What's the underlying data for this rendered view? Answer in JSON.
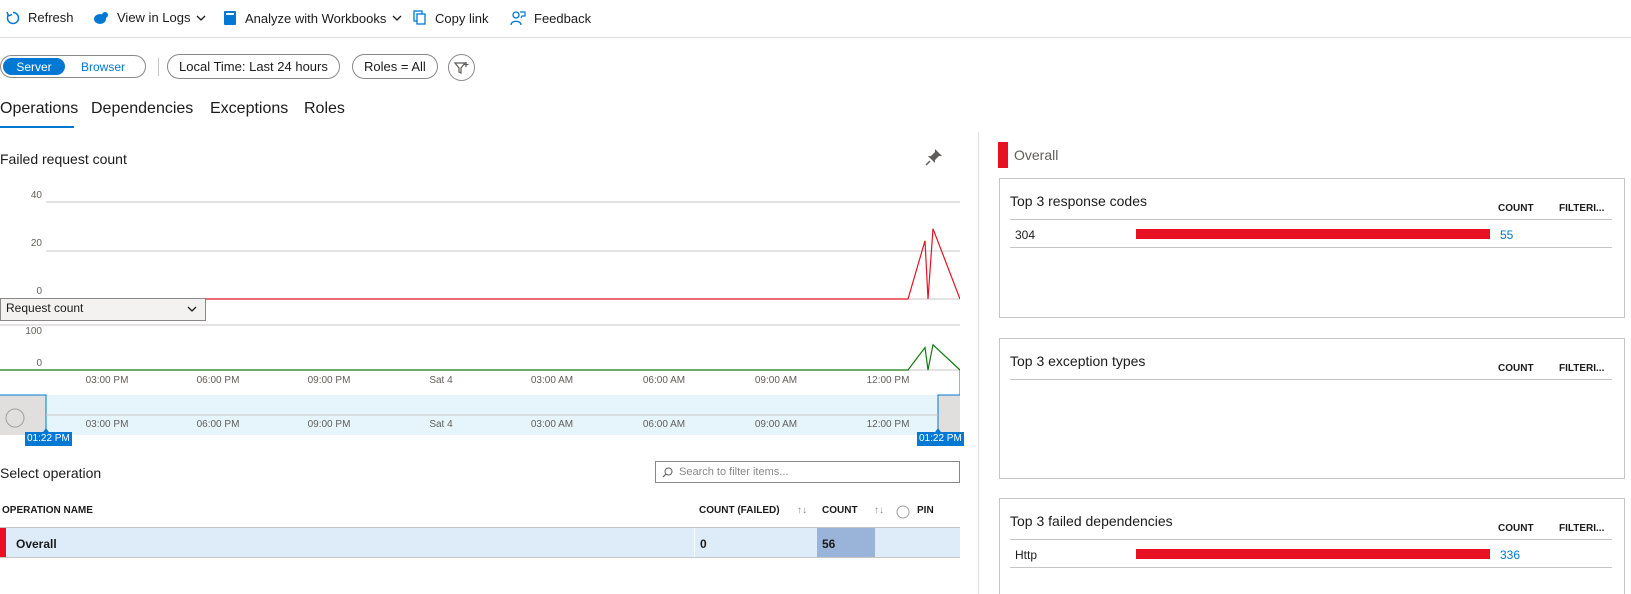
{
  "toolbar": {
    "refresh": "Refresh",
    "view_in_logs": "View in Logs",
    "analyze_workbooks": "Analyze with Workbooks",
    "copy_link": "Copy link",
    "feedback": "Feedback"
  },
  "filters": {
    "server": "Server",
    "browser": "Browser",
    "time_range": "Local Time: Last 24 hours",
    "roles": "Roles = All"
  },
  "tabs": [
    "Operations",
    "Dependencies",
    "Exceptions",
    "Roles"
  ],
  "main_chart": {
    "title": "Failed request count",
    "y_ticks": [
      "40",
      "20",
      "0"
    ]
  },
  "secondary_chart": {
    "metric_selected": "Request count",
    "y_ticks": [
      "100",
      "0"
    ]
  },
  "time_axis": [
    "03:00 PM",
    "06:00 PM",
    "09:00 PM",
    "Sat 4",
    "03:00 AM",
    "06:00 AM",
    "09:00 AM",
    "12:00 PM"
  ],
  "brush": {
    "start_label": "01:22 PM",
    "end_label": "01:22 PM"
  },
  "chart_data": [
    {
      "type": "line",
      "title": "Failed request count",
      "ylim": [
        0,
        40
      ],
      "grid": true,
      "series": [
        {
          "color": "#e81123",
          "x": [
            "01:22 PM",
            "12:00 PM",
            "12:30 PM",
            "12:45 PM",
            "01:00 PM",
            "01:10 PM",
            "01:22 PM"
          ],
          "values": [
            0,
            0,
            0,
            24,
            0,
            29,
            0
          ]
        }
      ]
    },
    {
      "type": "line",
      "ylim": [
        0,
        100
      ],
      "series": [
        {
          "color": "#107c10",
          "x": [
            "01:22 PM",
            "12:00 PM",
            "12:30 PM",
            "12:45 PM",
            "01:00 PM",
            "01:10 PM",
            "01:22 PM"
          ],
          "values": [
            0,
            0,
            0,
            50,
            0,
            56,
            0
          ]
        }
      ]
    }
  ],
  "operations": {
    "title": "Select operation",
    "search_placeholder": "Search to filter items...",
    "headers": {
      "name": "OPERATION NAME",
      "count_failed": "COUNT (FAILED)",
      "count": "COUNT",
      "pin": "PIN"
    },
    "rows": [
      {
        "name": "Overall",
        "count_failed": "0",
        "count": "56"
      }
    ]
  },
  "right_panel": {
    "overall_label": "Overall",
    "count_header": "COUNT",
    "filter_header": "FILTERI...",
    "response_codes": {
      "title": "Top 3 response codes",
      "rows": [
        {
          "label": "304",
          "value": "55"
        }
      ]
    },
    "exception_types": {
      "title": "Top 3 exception types",
      "rows": []
    },
    "failed_dependencies": {
      "title": "Top 3 failed dependencies",
      "rows": [
        {
          "label": "Http",
          "value": "336"
        }
      ]
    }
  },
  "colors": {
    "accent": "#0078d4",
    "failure": "#e81123",
    "success": "#107c10",
    "selection": "#deecf9"
  }
}
